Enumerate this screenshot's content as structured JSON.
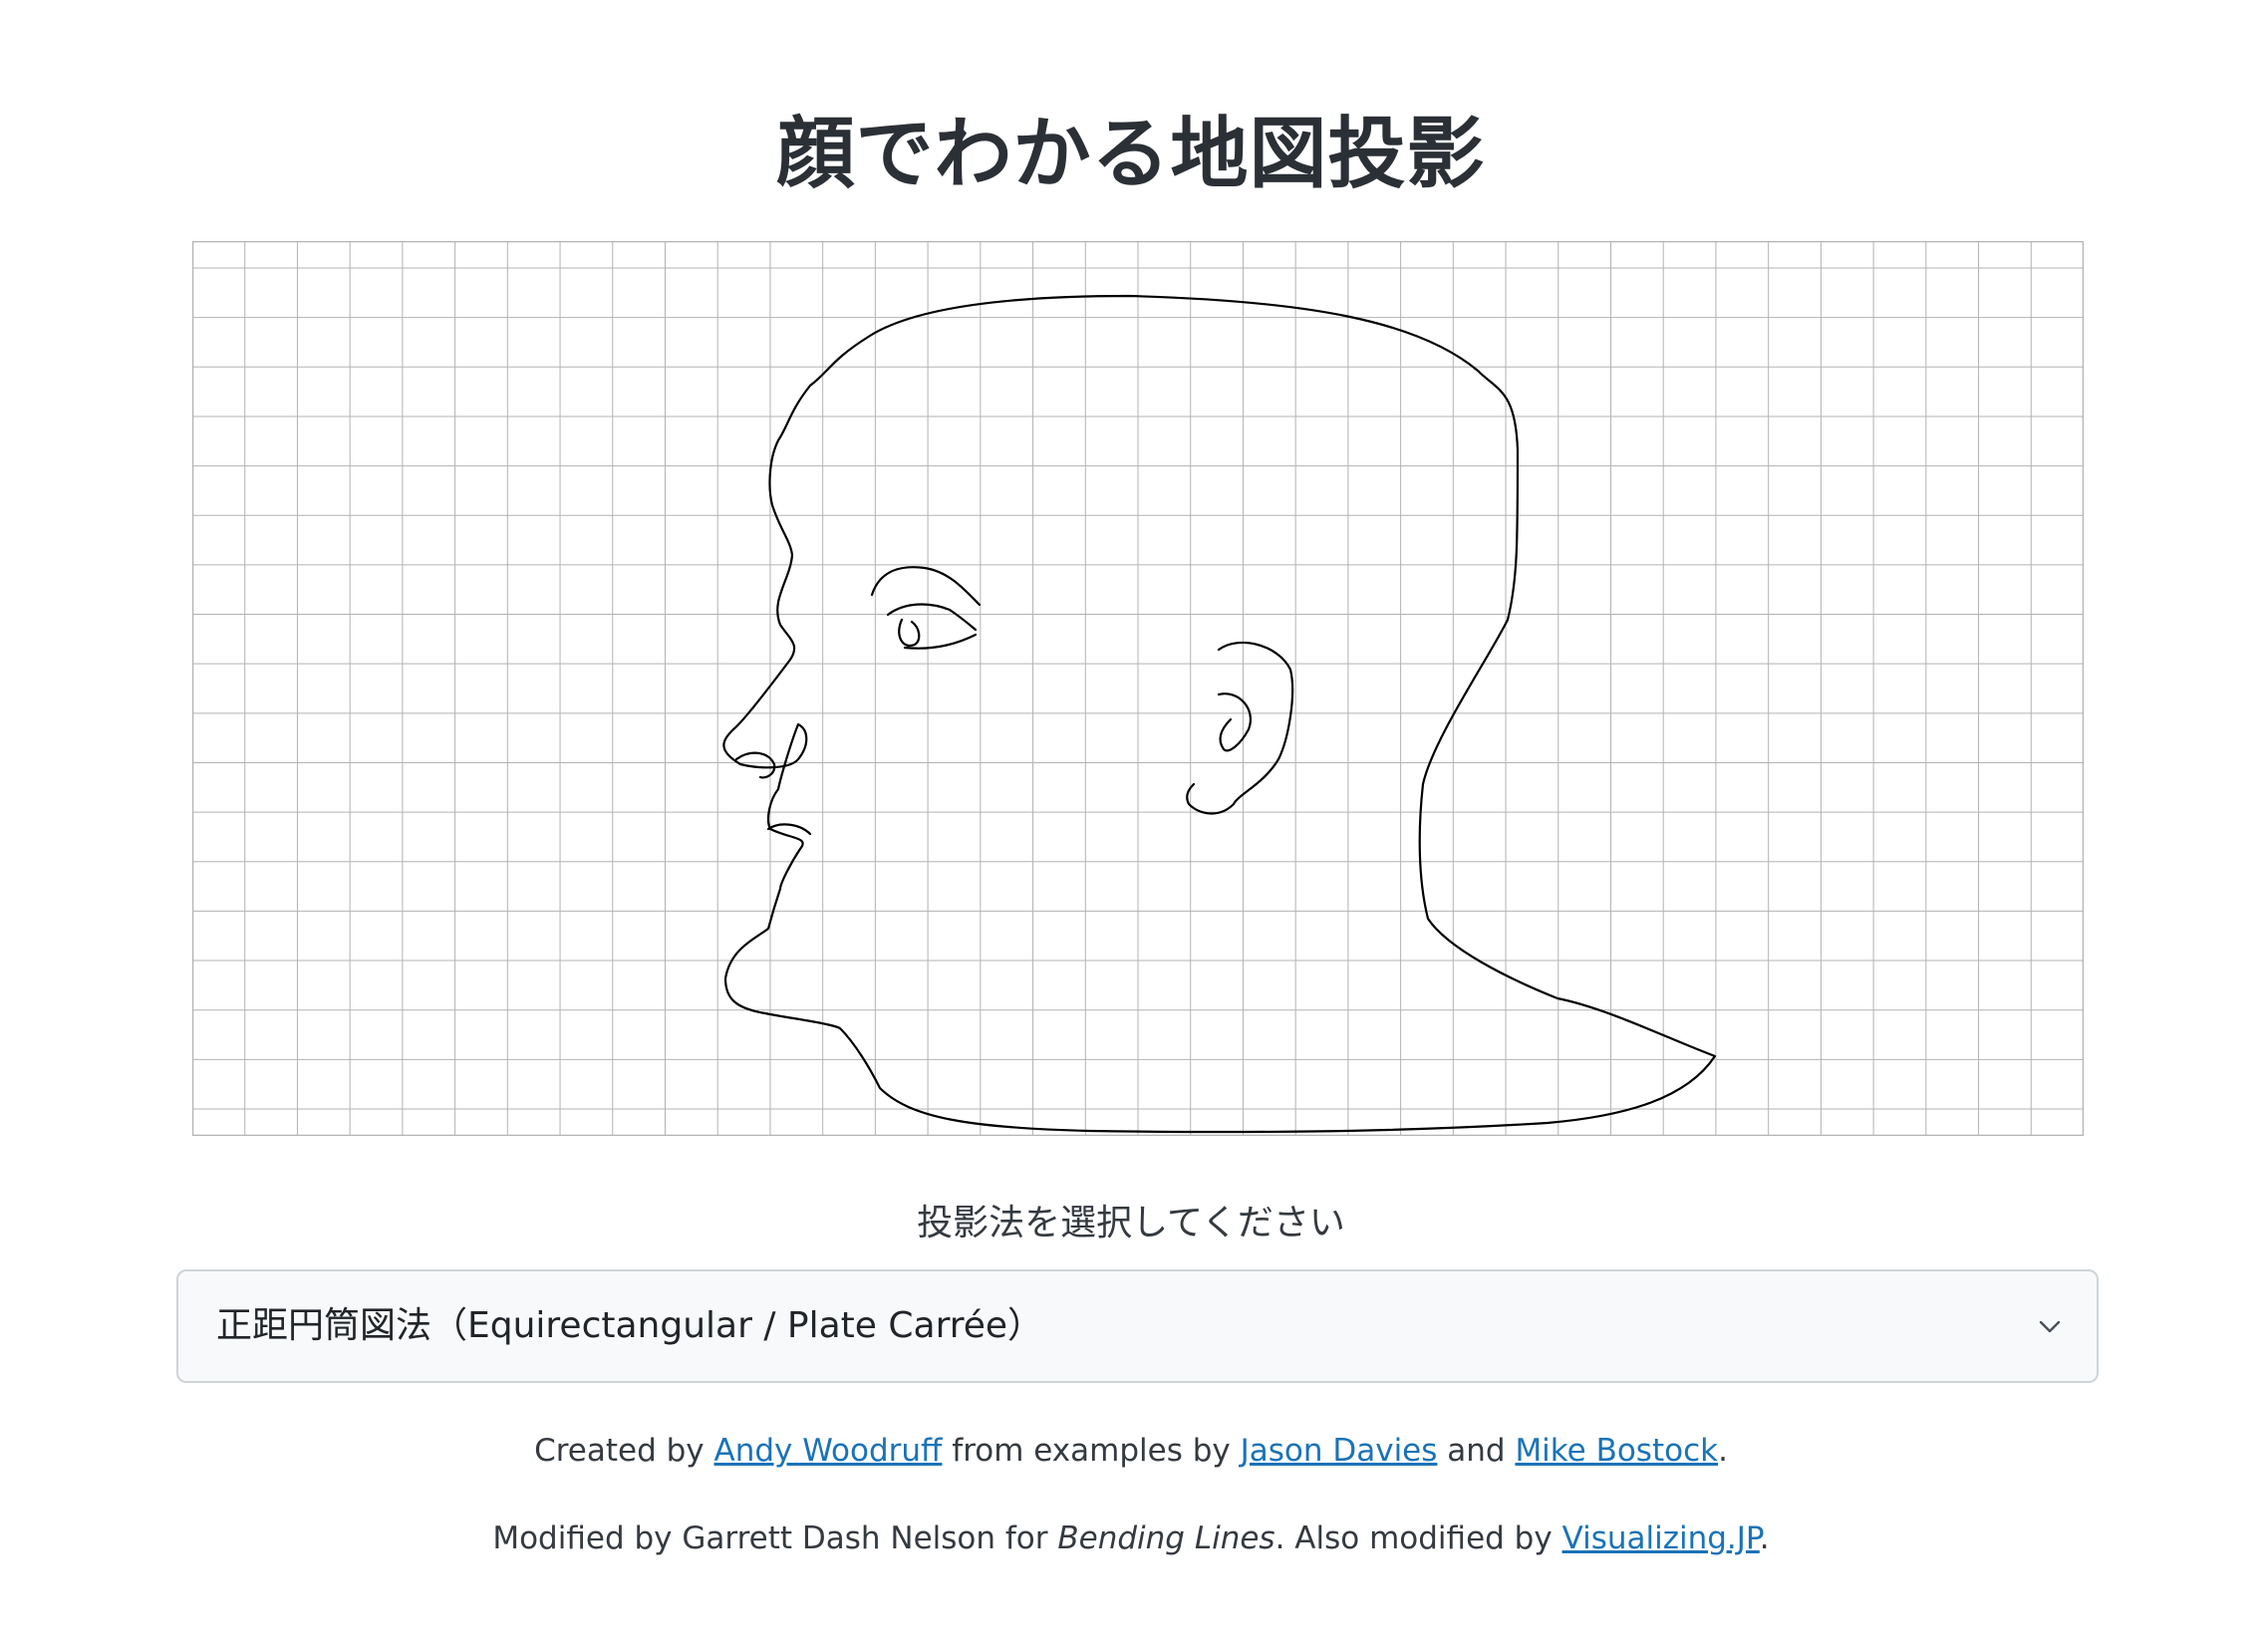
{
  "page": {
    "title": "顔でわかる地図投影"
  },
  "map": {
    "figure": "face-profile-outline",
    "graticule": true
  },
  "projection_select": {
    "label": "投影法を選択してください",
    "selected": "正距円筒図法（Equirectangular / Plate Carrée）"
  },
  "credits": {
    "line1": {
      "prefix": "Created by ",
      "author_link": "Andy Woodruff",
      "middle": " from examples by ",
      "link2": "Jason Davies",
      "and": " and ",
      "link3": "Mike Bostock",
      "suffix": "."
    },
    "line2": {
      "prefix": "Modified by Garrett Dash Nelson for ",
      "book": "Bending Lines",
      "middle": ". Also modified by ",
      "link": "Visualizing.JP",
      "suffix": "."
    }
  },
  "colors": {
    "title": "#2b3036",
    "link": "#1a73b8",
    "grid": "#b3b3b3",
    "select_bg": "#f8f9fa",
    "select_border": "#ced4da"
  }
}
